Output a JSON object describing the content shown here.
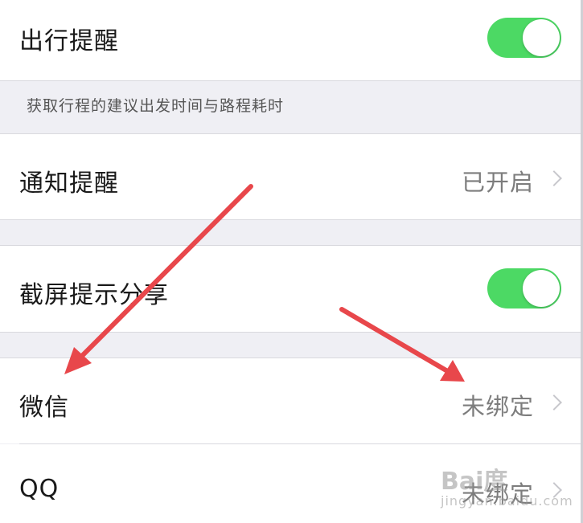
{
  "settings": {
    "trip_reminder": {
      "label": "出行提醒",
      "enabled": true
    },
    "trip_note": "获取行程的建议出发时间与路程耗时",
    "notification": {
      "label": "通知提醒",
      "value": "已开启"
    },
    "screenshot_share": {
      "label": "截屏提示分享",
      "enabled": true
    },
    "wechat": {
      "label": "微信",
      "value": "未绑定"
    },
    "qq": {
      "label": "QQ",
      "value": "未绑定"
    }
  },
  "watermark": {
    "main": "Bai度",
    "sub": "jingyan.baidu.com"
  },
  "colors": {
    "toggle_on": "#4cd964",
    "arrow": "#e8474b",
    "background": "#efeff4"
  },
  "icons": [
    "chevron-right-icon",
    "toggle-switch",
    "annotation-arrow"
  ]
}
